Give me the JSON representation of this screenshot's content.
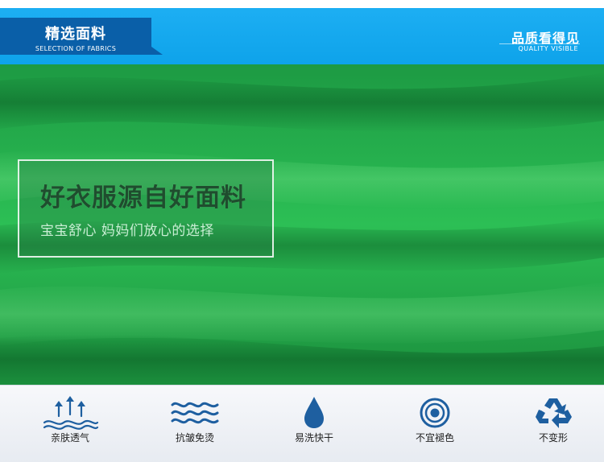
{
  "header": {
    "left_title": "精选面料",
    "left_subtitle": "SELECTION OF FABRICS",
    "right_title": "品质看得见",
    "right_subtitle": "QUALITY VISIBLE"
  },
  "caption": {
    "title": "好衣服源自好面料",
    "subtitle": "宝宝舒心 妈妈们放心的选择"
  },
  "features": [
    {
      "label": "亲肤透气",
      "icon": "breathable-arrows-icon"
    },
    {
      "label": "抗皱免烫",
      "icon": "waves-icon"
    },
    {
      "label": "易洗快干",
      "icon": "water-drop-icon"
    },
    {
      "label": "不宜褪色",
      "icon": "target-icon"
    },
    {
      "label": "不变形",
      "icon": "recycle-icon"
    }
  ],
  "colors": {
    "header_blue": "#0ea3ea",
    "header_dark": "#0a5fa8",
    "fabric_green": "#22a84a",
    "icon_blue": "#1e5fa0"
  }
}
